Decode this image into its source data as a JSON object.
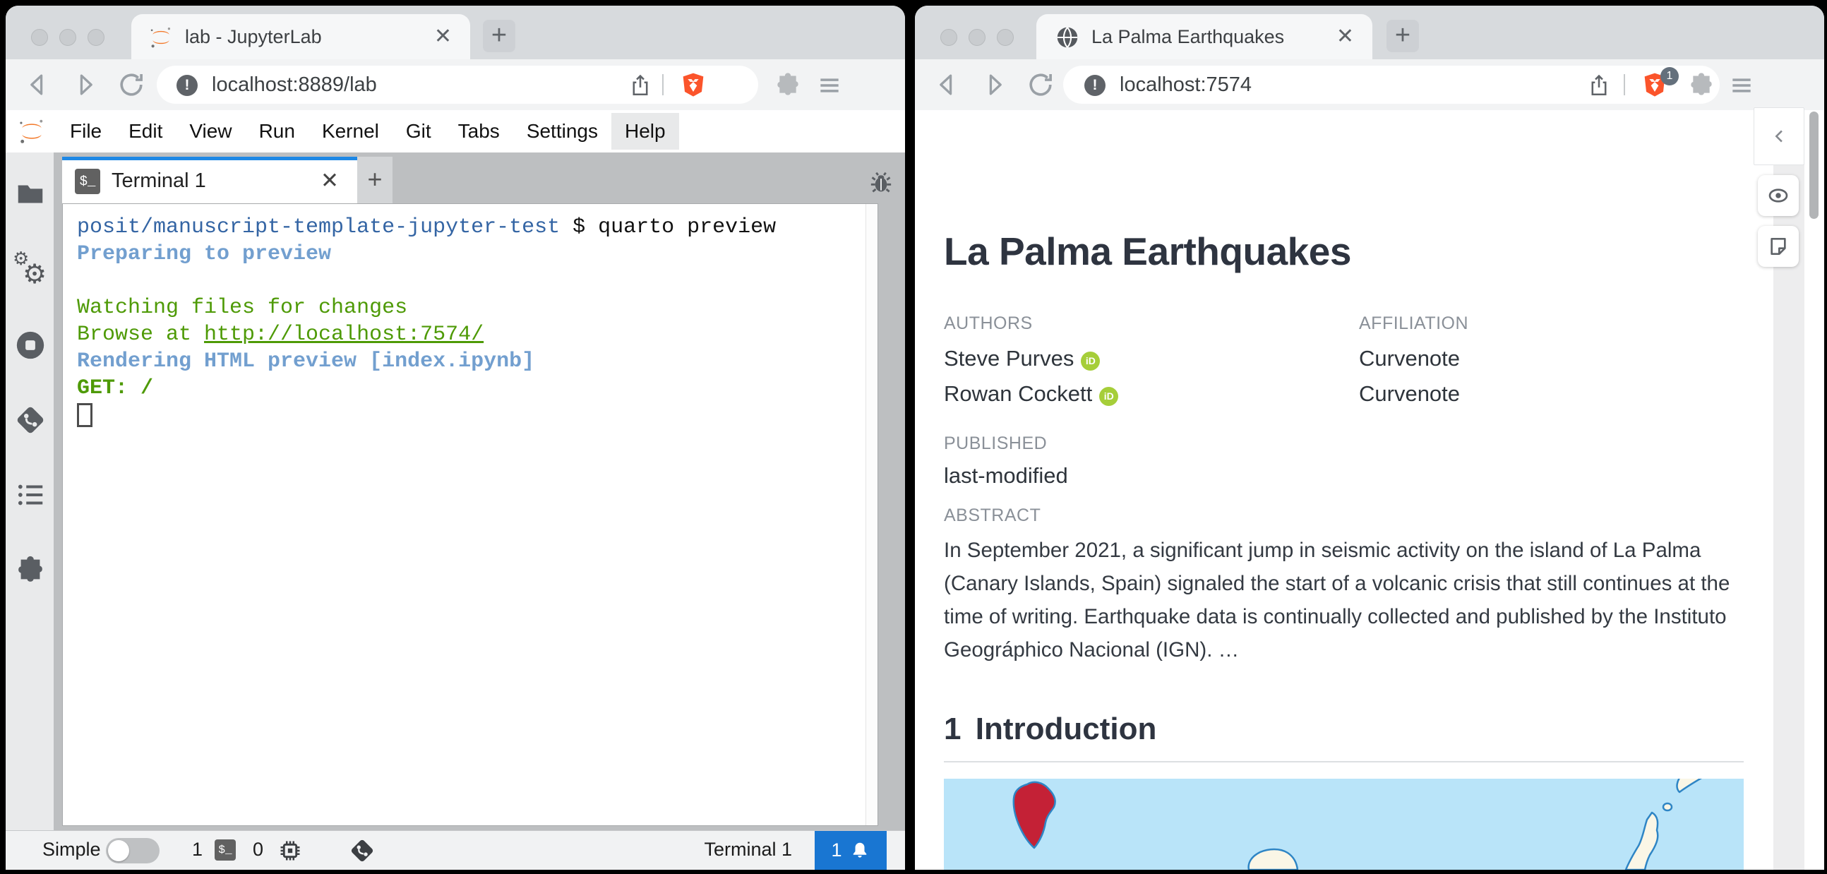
{
  "left_window": {
    "tab_title": "lab - JupyterLab",
    "url": "localhost:8889/lab",
    "menu_items": [
      "File",
      "Edit",
      "View",
      "Run",
      "Kernel",
      "Git",
      "Tabs",
      "Settings",
      "Help"
    ],
    "terminal_tab_label": "Terminal 1",
    "tab_close_glyph": "✕",
    "new_tab_glyph": "+",
    "terminal": {
      "prompt_path": "posit/manuscript-template-jupyter-test",
      "prompt_command": " $ quarto preview",
      "line_preparing": "Preparing to preview",
      "line_watching": "Watching files for changes",
      "line_browse_prefix": "Browse at ",
      "line_browse_link": "http://localhost:7574/",
      "line_rendering": "Rendering HTML preview [index.ipynb]",
      "line_get": "GET: /"
    },
    "statusbar": {
      "mode_label": "Simple",
      "terminal_count": "1",
      "kernel_count": "0",
      "current_item": "Terminal 1",
      "notification_count": "1"
    }
  },
  "right_window": {
    "tab_title": "La Palma Earthquakes",
    "url": "localhost:7574",
    "shield_badge": "1",
    "tab_close_glyph": "✕",
    "new_tab_glyph": "+",
    "article": {
      "title": "La Palma Earthquakes",
      "authors_label": "AUTHORS",
      "affiliation_label": "AFFILIATION",
      "authors": [
        {
          "name": "Steve Purves",
          "affiliation": "Curvenote"
        },
        {
          "name": "Rowan Cockett",
          "affiliation": "Curvenote"
        }
      ],
      "orcid_glyph": "iD",
      "published_label": "PUBLISHED",
      "published_value": "last-modified",
      "abstract_label": "ABSTRACT",
      "abstract_text": "In September 2021, a significant jump in seismic activity on the island of La Palma (Canary Islands, Spain) signaled the start of a volcanic crisis that still continues at the time of writing. Earthquake data is continually collected and published by the Instituto Geográphico Nacional (IGN). …",
      "section_number": "1",
      "section_title": "Introduction"
    }
  },
  "colors": {
    "accent_blue": "#1976d2",
    "jupyter_tab_accent": "#1e88e5",
    "terminal_path_blue": "#3465a4",
    "terminal_bright_blue": "#729fcf",
    "terminal_green": "#4e9a06",
    "brave_orange": "#fb542b",
    "jupyter_orange": "#f37726",
    "orcid_green": "#a6ce39",
    "map_ocean": "#b9e4f9",
    "map_island_fill": "#faf6e6",
    "map_island_stroke": "#2e85c5",
    "map_lapalma_red": "#c42136"
  }
}
